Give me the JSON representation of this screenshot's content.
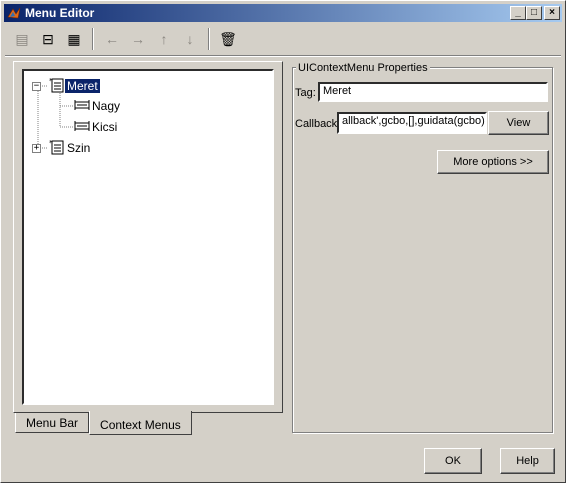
{
  "window": {
    "title": "Menu Editor"
  },
  "titlebar_buttons": {
    "minimize": "_",
    "maximize": "□",
    "close": "×"
  },
  "toolbar": {
    "tools": [
      {
        "name": "new-menu-icon",
        "glyph": "▤",
        "enabled": false
      },
      {
        "name": "new-menu-item-icon",
        "glyph": "⊟",
        "enabled": true
      },
      {
        "name": "new-context-menu-icon",
        "glyph": "▦",
        "enabled": true
      },
      {
        "name": "move-left-icon",
        "glyph": "←",
        "enabled": false
      },
      {
        "name": "move-right-icon",
        "glyph": "→",
        "enabled": false
      },
      {
        "name": "move-up-icon",
        "glyph": "↑",
        "enabled": false
      },
      {
        "name": "move-down-icon",
        "glyph": "↓",
        "enabled": false
      },
      {
        "name": "delete-icon",
        "glyph": "🗑",
        "enabled": true
      }
    ]
  },
  "tree": {
    "nodes": [
      {
        "label": "Meret",
        "expander": "−",
        "selected": true
      },
      {
        "label": "Nagy"
      },
      {
        "label": "Kicsi"
      },
      {
        "label": "Szin",
        "expander": "+"
      }
    ]
  },
  "tabs": {
    "menu_bar": "Menu Bar",
    "context_menus": "Context Menus"
  },
  "properties": {
    "group_title": "UIContextMenu Properties",
    "tag_label": "Tag:",
    "tag_value": "Meret",
    "callback_label": "Callback:",
    "callback_value": "allback',gcbo,[],guidata(gcbo))",
    "view_button": "View",
    "more_options_button": "More options >>"
  },
  "footer": {
    "ok_button": "OK",
    "help_button": "Help"
  }
}
